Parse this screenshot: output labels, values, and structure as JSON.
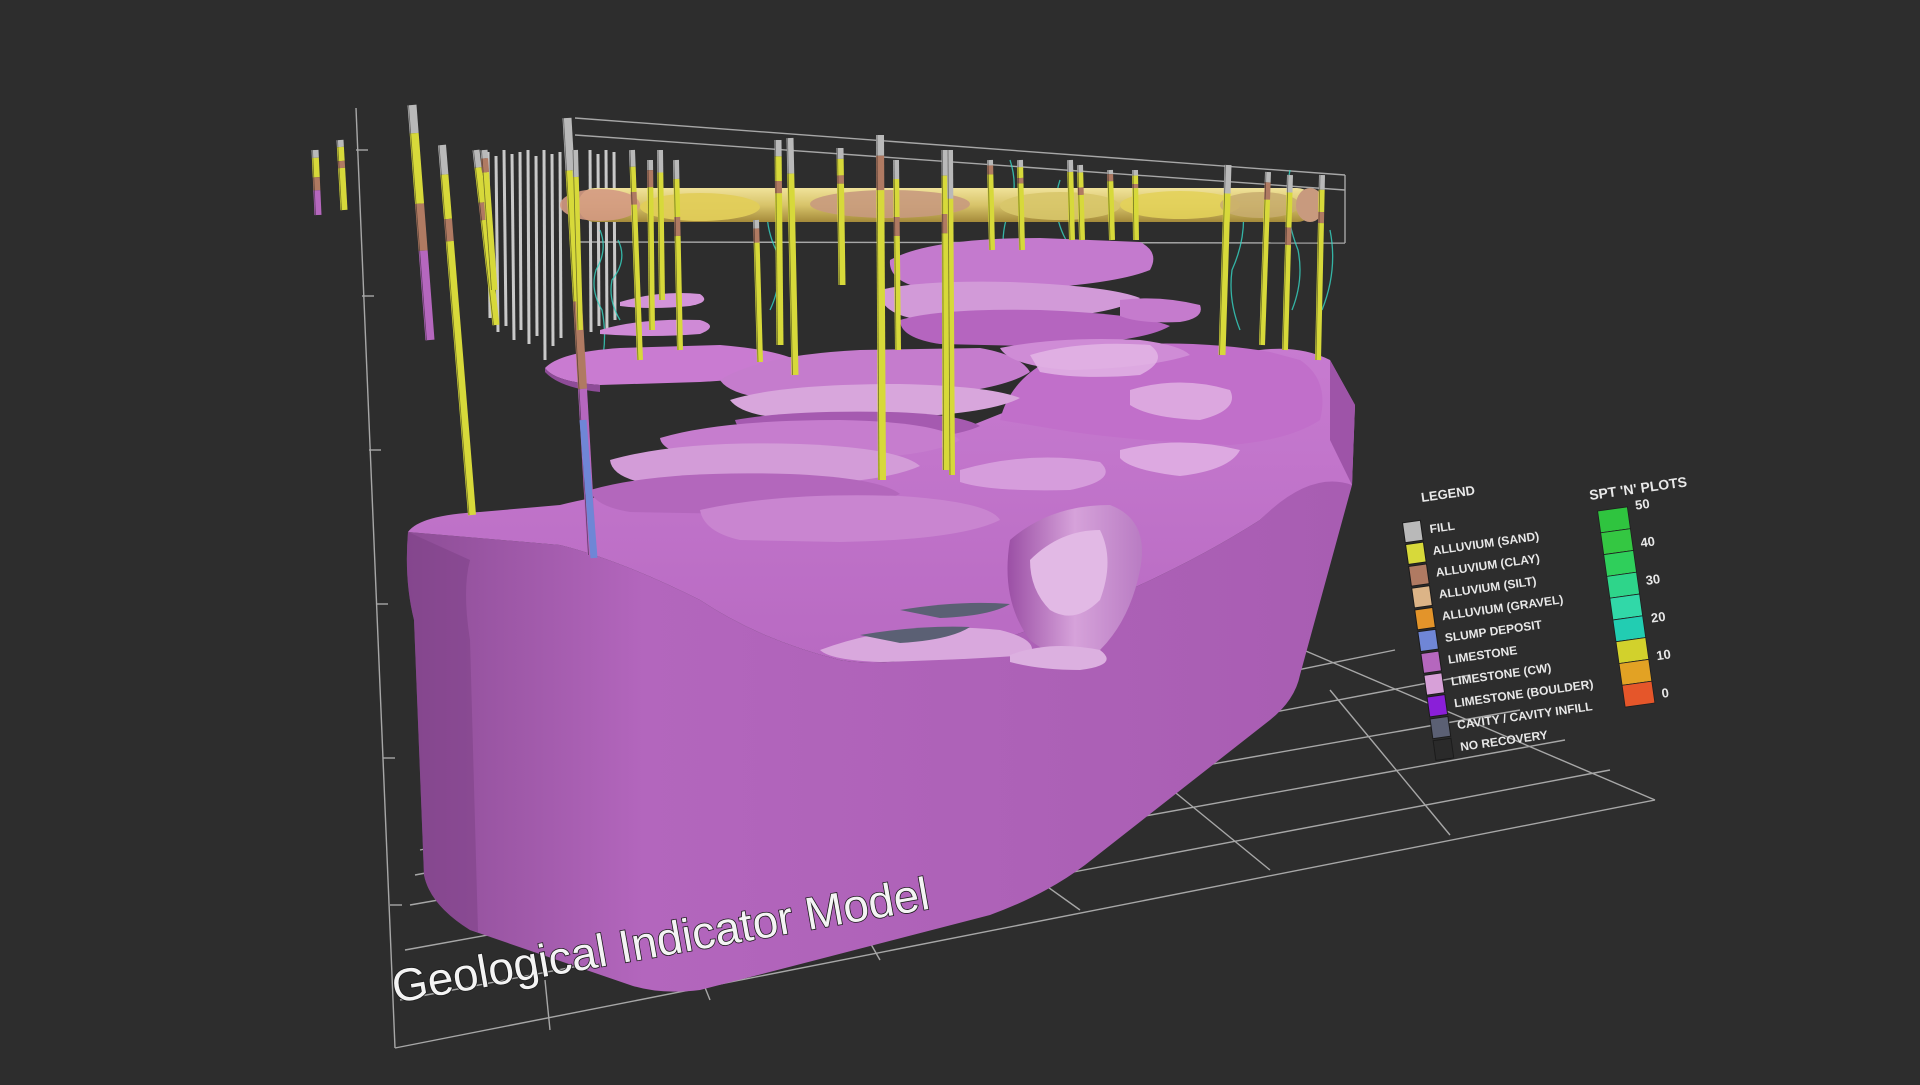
{
  "title": "Geological Indicator Model",
  "legend": {
    "title": "LEGEND",
    "items": [
      {
        "label": "FILL",
        "color": "#b9b9b9"
      },
      {
        "label": "ALLUVIUM (SAND)",
        "color": "#d7d93a"
      },
      {
        "label": "ALLUVIUM (CLAY)",
        "color": "#b07a62"
      },
      {
        "label": "ALLUVIUM (SILT)",
        "color": "#dcb487"
      },
      {
        "label": "ALLUVIUM (GRAVEL)",
        "color": "#e3942a"
      },
      {
        "label": "SLUMP DEPOSIT",
        "color": "#6f86d6"
      },
      {
        "label": "LIMESTONE",
        "color": "#b567be"
      },
      {
        "label": "LIMESTONE (CW)",
        "color": "#d7a0d8"
      },
      {
        "label": "LIMESTONE (BOULDER)",
        "color": "#8a1fd8"
      },
      {
        "label": "CAVITY / CAVITY INFILL",
        "color": "#5b6074"
      },
      {
        "label": "NO RECOVERY",
        "color": "#2a2a2a"
      }
    ]
  },
  "spt": {
    "title": "SPT 'N' PLOTS",
    "ticks": [
      "50",
      "40",
      "30",
      "20",
      "10",
      "0"
    ],
    "colors": [
      "#2fc43f",
      "#34c742",
      "#2fcf5b",
      "#2ed58a",
      "#31d8a8",
      "#22cdb2",
      "#d2d12c",
      "#e2a224",
      "#e5562a"
    ]
  },
  "colors": {
    "background": "#2d2d2d",
    "limestone": "#b567be",
    "limestone_cw": "#d7a0d8",
    "sand": "#d7d93a",
    "fill": "#b9b9b9",
    "clay": "#b07a62"
  }
}
